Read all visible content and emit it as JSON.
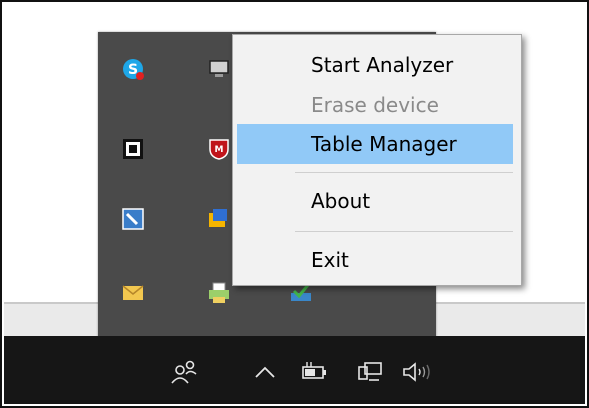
{
  "context_menu": {
    "items": [
      {
        "label": "Start Analyzer",
        "enabled": true,
        "highlighted": false
      },
      {
        "label": "Erase device",
        "enabled": false,
        "highlighted": false
      },
      {
        "label": "Table Manager",
        "enabled": true,
        "highlighted": true
      },
      {
        "label": "About",
        "enabled": true,
        "highlighted": false
      },
      {
        "label": "Exit",
        "enabled": true,
        "highlighted": false
      }
    ],
    "highlight_color": "#91c9f7"
  },
  "tray_overflow": {
    "icons": [
      "skype-icon",
      "network-monitor-icon",
      "chip-icon",
      "mcafee-icon",
      "tool-icon",
      "folder-sync-icon",
      "mail-icon",
      "printer-icon",
      "checkmark-drive-icon"
    ]
  },
  "taskbar": {
    "icons": [
      "people-icon",
      "show-hidden-icons-chevron",
      "battery-icon",
      "network-icon",
      "volume-icon"
    ],
    "background": "#161616"
  }
}
